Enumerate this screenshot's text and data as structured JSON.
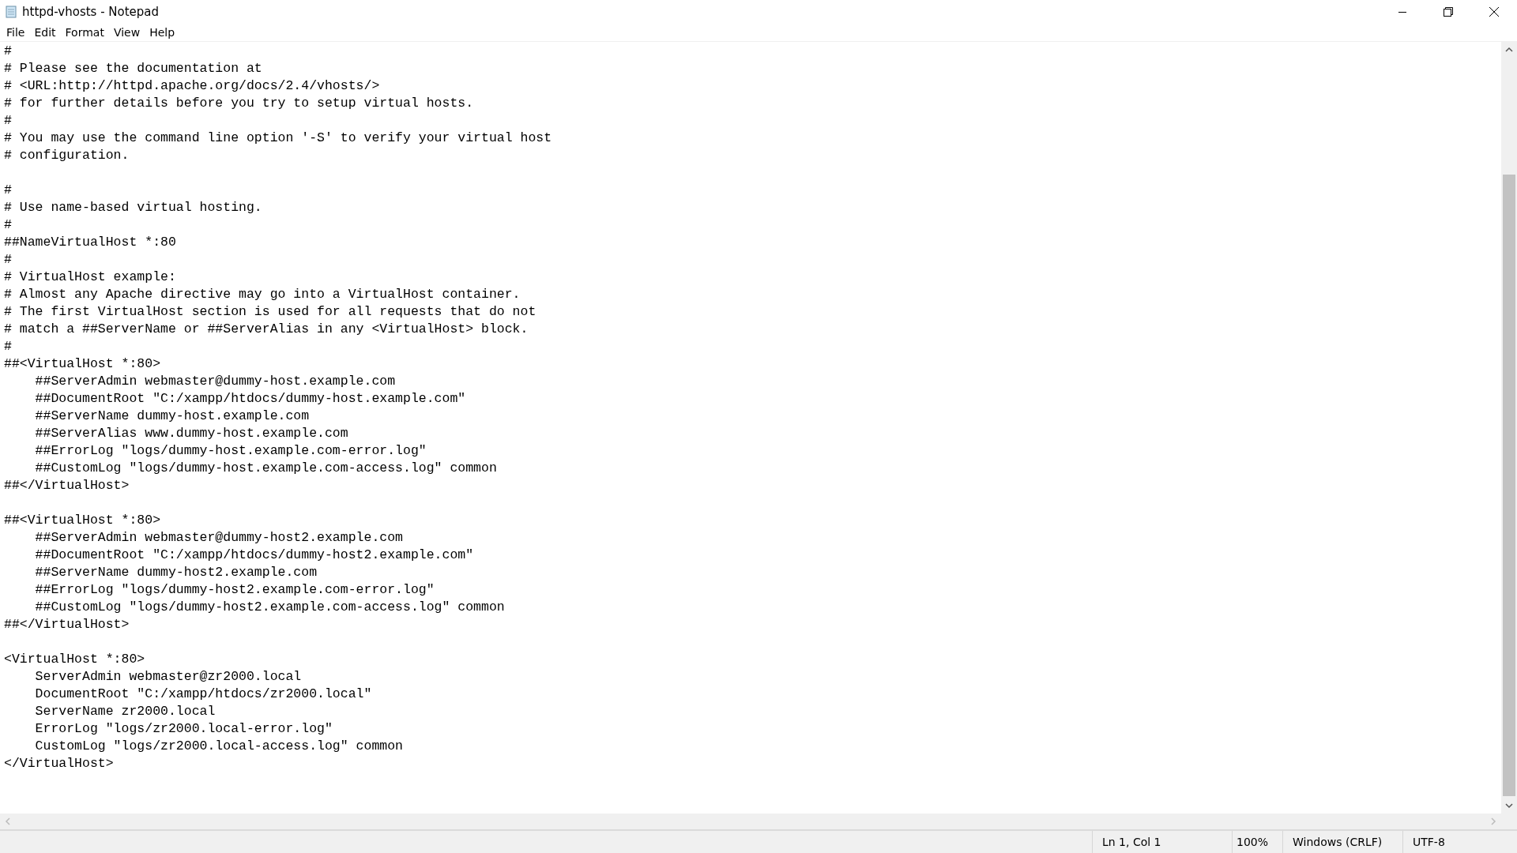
{
  "window": {
    "title": "httpd-vhosts - Notepad"
  },
  "menu": [
    "File",
    "Edit",
    "Format",
    "View",
    "Help"
  ],
  "editor": {
    "blocks": [
      [
        "#",
        "# Please see the documentation at",
        "# <URL:http://httpd.apache.org/docs/2.4/vhosts/>",
        "# for further details before you try to setup virtual hosts.",
        "#",
        "# You may use the command line option '-S' to verify your virtual host",
        "# configuration."
      ],
      [
        "#",
        "# Use name-based virtual hosting.",
        "#",
        "##NameVirtualHost *:80",
        "#",
        "# VirtualHost example:",
        "# Almost any Apache directive may go into a VirtualHost container.",
        "# The first VirtualHost section is used for all requests that do not",
        "# match a ##ServerName or ##ServerAlias in any <VirtualHost> block.",
        "#",
        "##<VirtualHost *:80>",
        "    ##ServerAdmin webmaster@dummy-host.example.com",
        "    ##DocumentRoot \"C:/xampp/htdocs/dummy-host.example.com\"",
        "    ##ServerName dummy-host.example.com",
        "    ##ServerAlias www.dummy-host.example.com",
        "    ##ErrorLog \"logs/dummy-host.example.com-error.log\"",
        "    ##CustomLog \"logs/dummy-host.example.com-access.log\" common",
        "##</VirtualHost>"
      ],
      [
        "##<VirtualHost *:80>",
        "    ##ServerAdmin webmaster@dummy-host2.example.com",
        "    ##DocumentRoot \"C:/xampp/htdocs/dummy-host2.example.com\"",
        "    ##ServerName dummy-host2.example.com",
        "    ##ErrorLog \"logs/dummy-host2.example.com-error.log\"",
        "    ##CustomLog \"logs/dummy-host2.example.com-access.log\" common",
        "##</VirtualHost>"
      ],
      [
        "<VirtualHost *:80>",
        "    ServerAdmin webmaster@zr2000.local",
        "    DocumentRoot \"C:/xampp/htdocs/zr2000.local\"",
        "    ServerName zr2000.local",
        "    ErrorLog \"logs/zr2000.local-error.log\"",
        "    CustomLog \"logs/zr2000.local-access.log\" common",
        "</VirtualHost>"
      ]
    ]
  },
  "status_bar": {
    "position": "Ln 1, Col 1",
    "zoom": "100%",
    "line_endings": "Windows (CRLF)",
    "encoding": "UTF-8"
  }
}
